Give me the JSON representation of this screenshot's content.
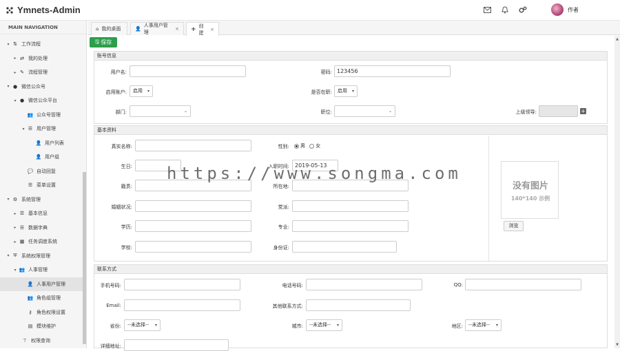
{
  "app": {
    "title": "Ymnets-Admin",
    "author": "作者"
  },
  "sidebar": {
    "header": "MAIN NAVIGATION",
    "items": [
      {
        "label": "工作流程",
        "icon": "sort-icon",
        "caret": "▾"
      },
      {
        "label": "我的处理",
        "icon": "exchange-icon",
        "caret": "▸"
      },
      {
        "label": "流程管理",
        "icon": "wrench-icon",
        "caret": "▸"
      },
      {
        "label": "微信公众号",
        "icon": "wechat-icon",
        "caret": "▾"
      },
      {
        "label": "微信公众平台",
        "icon": "wechat-icon",
        "caret": "▾"
      },
      {
        "label": "公众号管理",
        "icon": "users-icon",
        "caret": ""
      },
      {
        "label": "用户管理",
        "icon": "list-icon",
        "caret": "▾"
      },
      {
        "label": "用户列表",
        "icon": "user-icon",
        "caret": ""
      },
      {
        "label": "用户组",
        "icon": "user-icon",
        "caret": ""
      },
      {
        "label": "自动回复",
        "icon": "comment-icon",
        "caret": ""
      },
      {
        "label": "菜单设置",
        "icon": "list-icon",
        "caret": ""
      },
      {
        "label": "系统管理",
        "icon": "cogs-icon",
        "caret": "▾"
      },
      {
        "label": "基本信息",
        "icon": "list-icon",
        "caret": "▸"
      },
      {
        "label": "数据字典",
        "icon": "list-icon",
        "caret": "▸"
      },
      {
        "label": "任务调度系统",
        "icon": "calendar-icon",
        "caret": "▸"
      },
      {
        "label": "系统权限管理",
        "icon": "shield-icon",
        "caret": "▾"
      },
      {
        "label": "人事管理",
        "icon": "users-icon",
        "caret": "▾"
      },
      {
        "label": "人事用户管理",
        "icon": "user-icon",
        "caret": ""
      },
      {
        "label": "角色组管理",
        "icon": "users-icon",
        "caret": ""
      },
      {
        "label": "角色权限设置",
        "icon": "key-icon",
        "caret": ""
      },
      {
        "label": "模块维护",
        "icon": "module-icon",
        "caret": ""
      },
      {
        "label": "权限查询",
        "icon": "sitemap-icon",
        "caret": ""
      }
    ]
  },
  "tabs": [
    {
      "label": "我的桌面",
      "icon": "home-icon",
      "close": ""
    },
    {
      "label": "人事用户管理",
      "icon": "user-icon",
      "close": "×"
    },
    {
      "label": "创建",
      "icon": "plus-icon",
      "close": "×"
    }
  ],
  "toolbar": {
    "save_label": "保存"
  },
  "account": {
    "section": "账号信息",
    "username_label": "用户名:",
    "username_value": "",
    "password_label": "密码:",
    "password_value": "123456",
    "enable_label": "启用账户:",
    "enable_value": "启用",
    "online_label": "是否在职:",
    "online_value": "启用",
    "dept_label": "部门:",
    "dept_value": "",
    "post_label": "职位:",
    "post_value": "",
    "leader_label": "上级领导:",
    "leader_value": ""
  },
  "basic": {
    "section": "基本资料",
    "realname_label": "真实名称:",
    "realname_value": "",
    "sex_label": "性别:",
    "sex_male": "男",
    "sex_female": "女",
    "birthday_label": "生日:",
    "birthday_value": "",
    "joindate_label": "入职时间:",
    "joindate_value": "2019-05-13",
    "native_label": "籍贯:",
    "native_value": "",
    "location_label": "所在地:",
    "location_value": "",
    "marital_label": "婚姻状况:",
    "marital_value": "",
    "party_label": "党派:",
    "party_value": "",
    "education_label": "学历:",
    "education_value": "",
    "major_label": "专业:",
    "major_value": "",
    "school_label": "学校:",
    "school_value": "",
    "idcard_label": "身份证:",
    "idcard_value": "",
    "photo_text": "没有图片",
    "photo_size": "140*140 示例",
    "browse_label": "浏览"
  },
  "contact": {
    "section": "联系方式",
    "mobile_label": "手机号码:",
    "mobile_value": "",
    "phone_label": "电话号码:",
    "phone_value": "",
    "qq_label": "QQ:",
    "qq_value": "",
    "email_label": "Email:",
    "email_value": "",
    "other_label": "其他联系方式:",
    "other_value": "",
    "province_label": "省份:",
    "province_value": "--未选择--",
    "city_label": "城市:",
    "city_value": "--未选择--",
    "district_label": "地区:",
    "district_value": "--未选择--",
    "address_label": "详细地址:",
    "address_value": ""
  },
  "watermark": "https://www.songma.com"
}
